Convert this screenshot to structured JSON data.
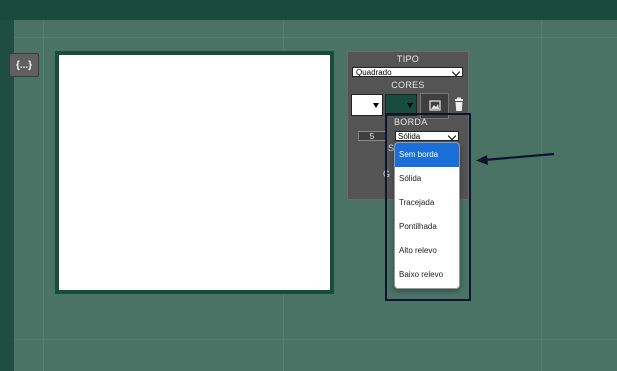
{
  "toolbar": {
    "code_button_label": "{...}"
  },
  "panel": {
    "tipo_title": "TIPO",
    "tipo_value": "Quadrado",
    "cores_title": "CORES",
    "fill_color": "#ffffff",
    "border_color": "#184d3e",
    "borda_title": "BORDA",
    "border_size": "5",
    "border_style_value": "Sólida",
    "partial_label_1": "S",
    "partial_label_2": "G"
  },
  "dropdown": {
    "options": [
      "Sem borda",
      "Sólida",
      "Tracejada",
      "Pontilhada",
      "Alto relevo",
      "Baixo relevo"
    ]
  },
  "colors": {
    "background": "#4a7366",
    "selected_option": "#1a6fd9",
    "highlight_border": "#0c1430"
  }
}
